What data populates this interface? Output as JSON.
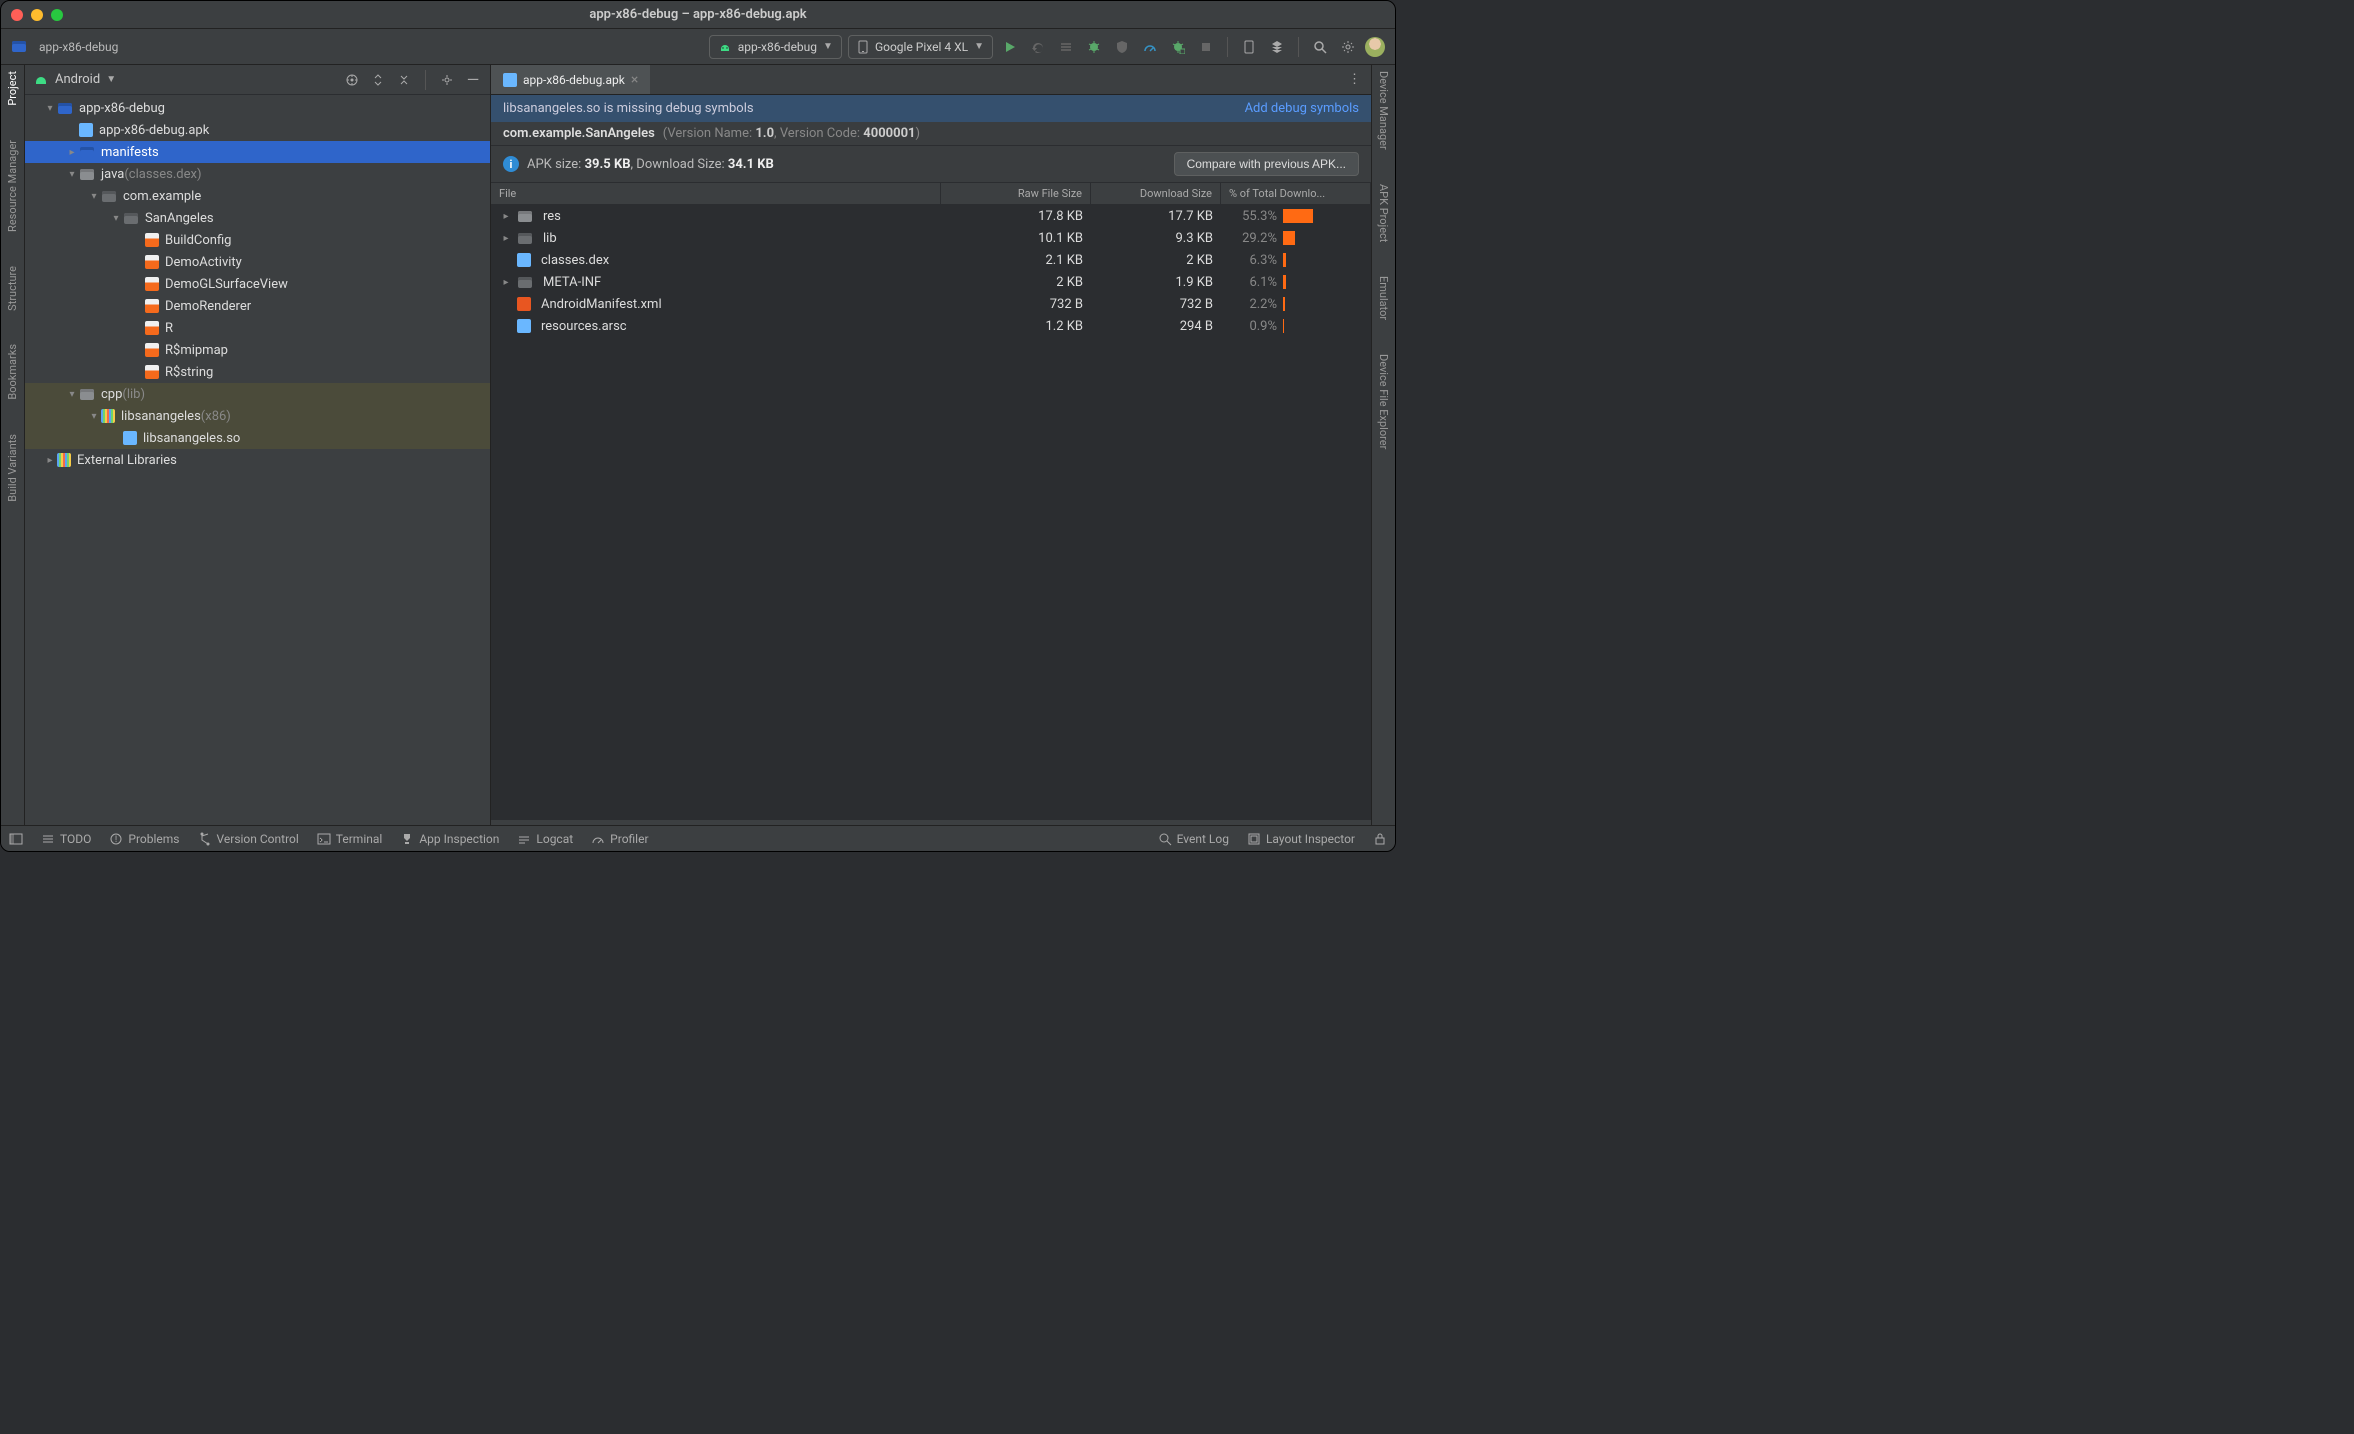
{
  "window_title": "app-x86-debug – app-x86-debug.apk",
  "breadcrumb": "app-x86-debug",
  "toolbar": {
    "config": "app-x86-debug",
    "device": "Google Pixel 4 XL"
  },
  "leftrail": [
    {
      "label": "Project",
      "active": true
    },
    {
      "label": "Resource Manager",
      "active": false
    },
    {
      "label": "Structure",
      "active": false
    },
    {
      "label": "Bookmarks",
      "active": false
    },
    {
      "label": "Build Variants",
      "active": false
    }
  ],
  "rightrail": [
    {
      "label": "Device Manager"
    },
    {
      "label": "APK Project"
    },
    {
      "label": "Emulator"
    },
    {
      "label": "Device File Explorer"
    }
  ],
  "sidebar": {
    "view": "Android"
  },
  "tree": [
    {
      "depth": 0,
      "arrow": "exp",
      "icon": "folder-blue",
      "label": "app-x86-debug"
    },
    {
      "depth": 1,
      "arrow": "none",
      "icon": "apk",
      "label": "app-x86-debug.apk"
    },
    {
      "depth": 1,
      "arrow": "col",
      "icon": "folder-blue",
      "label": "manifests",
      "sel": "sel"
    },
    {
      "depth": 1,
      "arrow": "exp",
      "icon": "folder-grey",
      "label": "java",
      "suffix": "(classes.dex)"
    },
    {
      "depth": 2,
      "arrow": "exp",
      "icon": "folder-dark",
      "label": "com.example"
    },
    {
      "depth": 3,
      "arrow": "exp",
      "icon": "folder-dark",
      "label": "SanAngeles"
    },
    {
      "depth": 4,
      "arrow": "none",
      "icon": "code",
      "label": "BuildConfig"
    },
    {
      "depth": 4,
      "arrow": "none",
      "icon": "code",
      "label": "DemoActivity"
    },
    {
      "depth": 4,
      "arrow": "none",
      "icon": "code",
      "label": "DemoGLSurfaceView"
    },
    {
      "depth": 4,
      "arrow": "none",
      "icon": "code",
      "label": "DemoRenderer"
    },
    {
      "depth": 4,
      "arrow": "none",
      "icon": "code",
      "label": "R"
    },
    {
      "depth": 4,
      "arrow": "none",
      "icon": "code",
      "label": "R$mipmap"
    },
    {
      "depth": 4,
      "arrow": "none",
      "icon": "code",
      "label": "R$string"
    },
    {
      "depth": 1,
      "arrow": "exp",
      "icon": "folder-grey",
      "label": "cpp",
      "suffix": "(lib)",
      "sel": "selalt"
    },
    {
      "depth": 2,
      "arrow": "exp",
      "icon": "stripes",
      "label": "libsanangeles",
      "suffix": "(x86)",
      "sel": "selalt"
    },
    {
      "depth": 3,
      "arrow": "none",
      "icon": "bin",
      "label": "libsanangeles.so",
      "sel": "selalt"
    },
    {
      "depth": 0,
      "arrow": "col",
      "icon": "stripes",
      "label": "External Libraries"
    }
  ],
  "tab": {
    "label": "app-x86-debug.apk"
  },
  "banner": {
    "text": "libsanangeles.so is missing debug symbols",
    "link": "Add debug symbols"
  },
  "pkginfo": {
    "package": "com.example.SanAngeles",
    "version_name_label": "(Version Name: ",
    "version_name": "1.0",
    "version_code_label": ", Version Code: ",
    "version_code": "4000001",
    "tail": ")"
  },
  "apksize": {
    "label": "APK size: ",
    "size": "39.5 KB",
    "dl_label": ", Download Size: ",
    "dl": "34.1 KB",
    "button": "Compare with previous APK..."
  },
  "columns": {
    "file": "File",
    "raw": "Raw File Size",
    "dl": "Download Size",
    "pct": "% of Total Downlo..."
  },
  "files": [
    {
      "arrow": "col",
      "icon": "folder-grey",
      "name": "res",
      "raw": "17.8 KB",
      "dl": "17.7 KB",
      "pct": "55.3%",
      "bar": 30
    },
    {
      "arrow": "col",
      "icon": "folder-dark",
      "name": "lib",
      "raw": "10.1 KB",
      "dl": "9.3 KB",
      "pct": "29.2%",
      "bar": 12
    },
    {
      "arrow": "none",
      "icon": "bin",
      "name": "classes.dex",
      "raw": "2.1 KB",
      "dl": "2 KB",
      "pct": "6.3%",
      "bar": 3
    },
    {
      "arrow": "col",
      "icon": "folder-dark",
      "name": "META-INF",
      "raw": "2 KB",
      "dl": "1.9 KB",
      "pct": "6.1%",
      "bar": 3
    },
    {
      "arrow": "none",
      "icon": "xml",
      "name": "AndroidManifest.xml",
      "raw": "732 B",
      "dl": "732 B",
      "pct": "2.2%",
      "bar": 2
    },
    {
      "arrow": "none",
      "icon": "bin",
      "name": "resources.arsc",
      "raw": "1.2 KB",
      "dl": "294 B",
      "pct": "0.9%",
      "bar": 1
    }
  ],
  "statusbar": {
    "items_left": [
      "TODO",
      "Problems",
      "Version Control",
      "Terminal",
      "App Inspection",
      "Logcat",
      "Profiler"
    ],
    "items_right": [
      "Event Log",
      "Layout Inspector"
    ]
  }
}
